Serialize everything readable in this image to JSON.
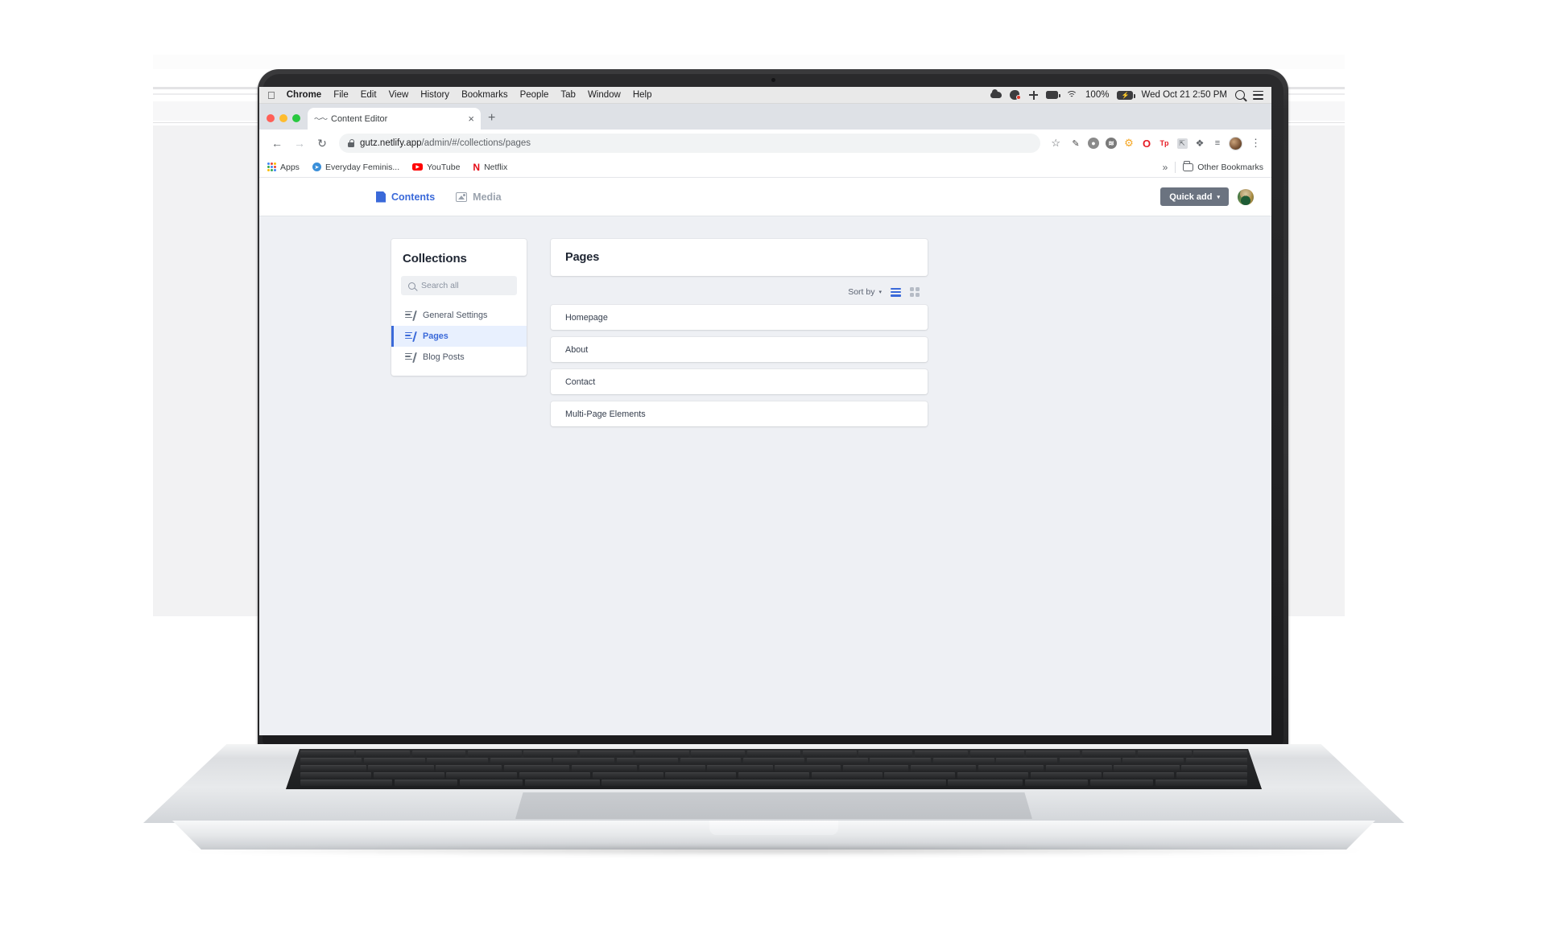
{
  "os_menubar": {
    "apple_icon": "apple-logo",
    "items": [
      {
        "label": "Chrome",
        "bold": true
      },
      {
        "label": "File",
        "bold": false
      },
      {
        "label": "Edit",
        "bold": false
      },
      {
        "label": "View",
        "bold": false
      },
      {
        "label": "History",
        "bold": false
      },
      {
        "label": "Bookmarks",
        "bold": false
      },
      {
        "label": "People",
        "bold": false
      },
      {
        "label": "Tab",
        "bold": false
      },
      {
        "label": "Window",
        "bold": false
      },
      {
        "label": "Help",
        "bold": false
      }
    ],
    "status": {
      "battery_percent": "100%",
      "datetime": "Wed Oct 21  2:50 PM",
      "icons": [
        "cloud-icon",
        "screen-record-icon",
        "xcode-icon",
        "battery-icon",
        "wifi-icon",
        "search-icon",
        "control-center-icon"
      ]
    }
  },
  "browser": {
    "tab": {
      "title": "Content Editor",
      "favicon": "site-favicon",
      "close_label": "×"
    },
    "new_tab_label": "+",
    "nav": {
      "back": "←",
      "forward": "→",
      "reload": "↻"
    },
    "url": {
      "domain": "gutz.netlify.app",
      "path": "/admin/#/collections/pages",
      "lock_icon": "lock-icon"
    },
    "star_label": "☆",
    "kebab_label": "⋮",
    "extensions": [
      {
        "name": "eyedropper-extension",
        "glyph": "✒",
        "color": "#e04a3f"
      },
      {
        "name": "shield-extension",
        "glyph": "●",
        "color": "#7d7d7d"
      },
      {
        "name": "wave-extension",
        "glyph": "≋",
        "color": "#6e6e6e"
      },
      {
        "name": "gear-extension",
        "glyph": "⚙",
        "color": "#f5a623"
      },
      {
        "name": "opera-extension",
        "glyph": "O",
        "color": "#e61b23"
      },
      {
        "name": "typography-extension",
        "glyph": "Tp",
        "color": "#e61b23"
      },
      {
        "name": "box-extension",
        "glyph": "⬚",
        "color": "#9aa0a6"
      },
      {
        "name": "puzzle-extension",
        "glyph": "❖",
        "color": "#5f6368"
      },
      {
        "name": "reading-list-extension",
        "glyph": "≡",
        "color": "#5f6368"
      }
    ],
    "bookmarks": [
      {
        "label": "Apps",
        "icon": "apps-grid-icon"
      },
      {
        "label": "Everyday Feminis...",
        "icon": "compass-icon"
      },
      {
        "label": "YouTube",
        "icon": "youtube-icon"
      },
      {
        "label": "Netflix",
        "icon": "netflix-icon"
      }
    ],
    "bookmarks_overflow": "»",
    "other_bookmarks": "Other Bookmarks"
  },
  "app": {
    "tabs": [
      {
        "label": "Contents",
        "icon": "document-icon",
        "active": true
      },
      {
        "label": "Media",
        "icon": "image-icon",
        "active": false
      }
    ],
    "quick_add": {
      "label": "Quick add",
      "caret": "▾"
    },
    "avatar": "user-avatar",
    "sidebar": {
      "title": "Collections",
      "search_placeholder": "Search all",
      "search_value": "",
      "items": [
        {
          "label": "General Settings",
          "active": false
        },
        {
          "label": "Pages",
          "active": true
        },
        {
          "label": "Blog Posts",
          "active": false
        }
      ]
    },
    "main": {
      "title": "Pages",
      "sort_label": "Sort by",
      "sort_caret": "▾",
      "view_modes": [
        {
          "name": "list-view",
          "active": true
        },
        {
          "name": "grid-view",
          "active": false
        }
      ],
      "entries": [
        {
          "label": "Homepage"
        },
        {
          "label": "About"
        },
        {
          "label": "Contact"
        },
        {
          "label": "Multi-Page Elements"
        }
      ]
    }
  },
  "colors": {
    "accent_blue": "#3a69d9",
    "app_bg": "#eef0f4",
    "card_bg": "#ffffff",
    "quick_add_bg": "#6b7380",
    "active_item_bg": "#e8f0fe"
  }
}
